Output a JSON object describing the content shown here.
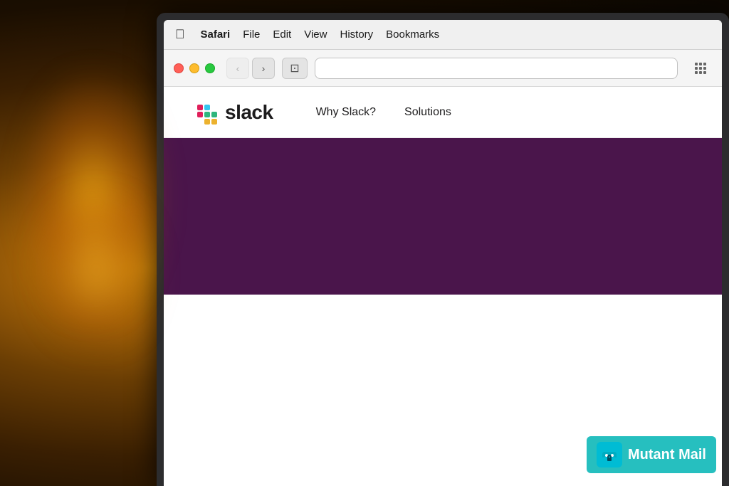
{
  "background": {
    "description": "Dark warm bokeh background with glowing lamp"
  },
  "macos": {
    "menubar": {
      "apple_label": "",
      "items": [
        {
          "label": "Safari",
          "bold": true
        },
        {
          "label": "File",
          "bold": false
        },
        {
          "label": "Edit",
          "bold": false
        },
        {
          "label": "View",
          "bold": false
        },
        {
          "label": "History",
          "bold": false
        },
        {
          "label": "Bookmarks",
          "bold": false
        }
      ]
    }
  },
  "safari": {
    "toolbar": {
      "back_label": "‹",
      "forward_label": "›",
      "sidebar_label": "⊡",
      "grid_label": "⋯"
    }
  },
  "slack_website": {
    "logo_text": "slack",
    "nav_links": [
      {
        "label": "Why Slack?"
      },
      {
        "label": "Solutions"
      }
    ],
    "hero_color": "#4a154b"
  },
  "watermark": {
    "brand": "Mutant Mail",
    "icon_emoji": "📧"
  }
}
